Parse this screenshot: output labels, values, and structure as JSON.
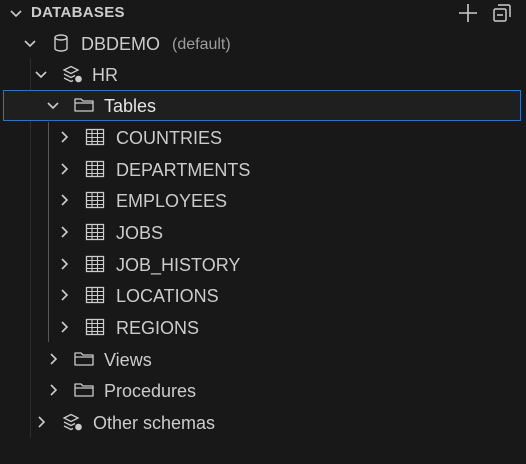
{
  "header": {
    "title": "DATABASES",
    "actions": [
      {
        "icon": "add-icon"
      },
      {
        "icon": "collapse-all-icon"
      }
    ]
  },
  "tree": {
    "connection": {
      "label": "DBDEMO",
      "description": "(default)",
      "icon": "database-icon",
      "expanded": true
    },
    "schema": {
      "label": "HR",
      "icon": "schema-icon",
      "expanded": true
    },
    "tables_folder": {
      "label": "Tables",
      "icon": "folder-icon",
      "expanded": true,
      "selected": true
    },
    "tables": [
      {
        "label": "COUNTRIES"
      },
      {
        "label": "DEPARTMENTS"
      },
      {
        "label": "EMPLOYEES"
      },
      {
        "label": "JOBS"
      },
      {
        "label": "JOB_HISTORY"
      },
      {
        "label": "LOCATIONS"
      },
      {
        "label": "REGIONS"
      }
    ],
    "views_folder": {
      "label": "Views",
      "icon": "folder-icon",
      "expanded": false
    },
    "procedures_folder": {
      "label": "Procedures",
      "icon": "folder-icon",
      "expanded": false
    },
    "other_schemas": {
      "label": "Other schemas",
      "icon": "schema-icon",
      "expanded": false
    }
  },
  "colors": {
    "background": "#181818",
    "text": "#cccccc",
    "description": "#9d9d9d",
    "selection_border": "#2c74c6",
    "indent_guide": "#585858"
  }
}
